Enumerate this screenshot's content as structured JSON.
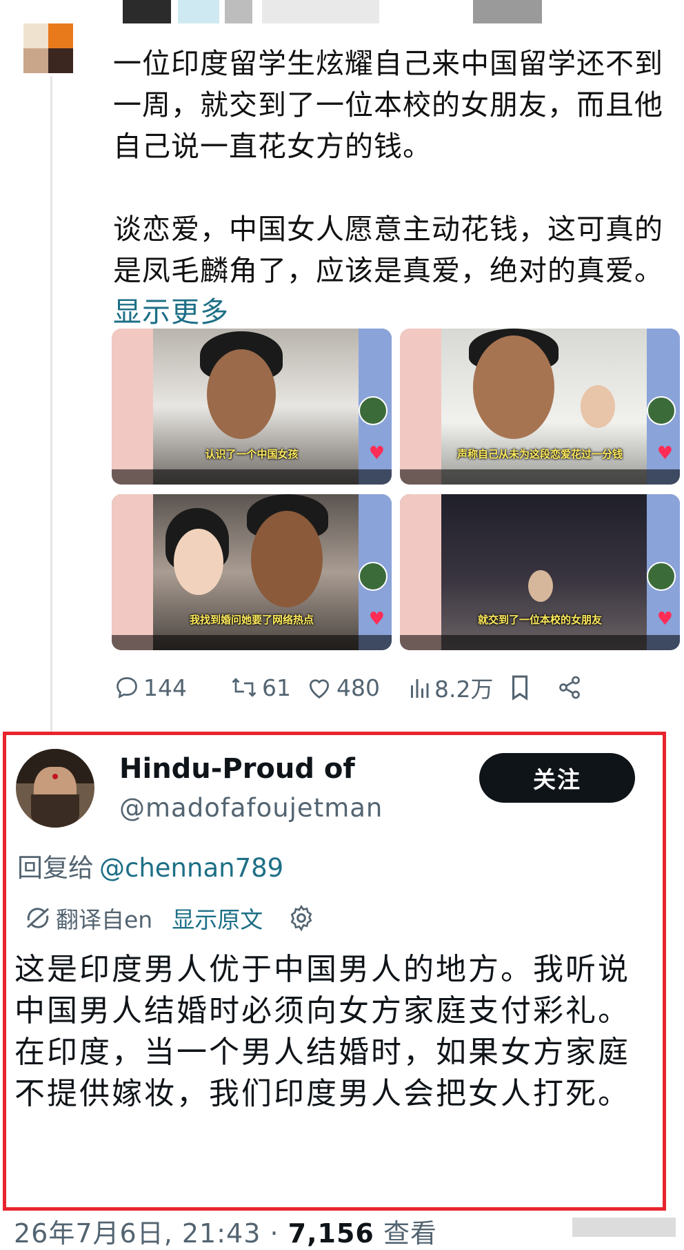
{
  "post": {
    "paragraph1": "一位印度留学生炫耀自己来中国留学还不到一周，就交到了一位本校的女朋友，而且他自己说一直花女方的钱。",
    "paragraph2": "谈恋爱，中国女人愿意主动花钱，这可真的是凤毛麟角了，应该是真爱，绝对的真爱。",
    "show_more": "显示更多"
  },
  "media": [
    {
      "caption": "认识了一个中国女孩"
    },
    {
      "caption": "声称自己从未为这段恋爱花过一分钱"
    },
    {
      "caption": "我找到婚问她要了网络热点"
    },
    {
      "caption": "就交到了一位本校的女朋友"
    }
  ],
  "actions": {
    "replies": "144",
    "reposts": "61",
    "likes": "480",
    "views": "8.2万"
  },
  "reply": {
    "display_name": "Hindu-Proud of",
    "handle": "@madofafoujetman",
    "follow_label": "关注",
    "reply_to_label": "回复给",
    "reply_to_handle": "@chennan789",
    "translated_from": "翻译自en",
    "show_original": "显示原文",
    "text": "这是印度男人优于中国男人的地方。我听说中国男人结婚时必须向女方家庭支付彩礼。在印度，当一个男人结婚时，如果女方家庭不提供嫁妆，我们印度男人会把女人打死。"
  },
  "footer": {
    "date": "26年7月6日, 21:43 ·",
    "views_count": "7,156",
    "views_label": "查看"
  },
  "colors": {
    "link": "#1d6f86",
    "highlight_border": "#e8242c",
    "follow_button": "#0f1419",
    "muted": "#536471"
  }
}
